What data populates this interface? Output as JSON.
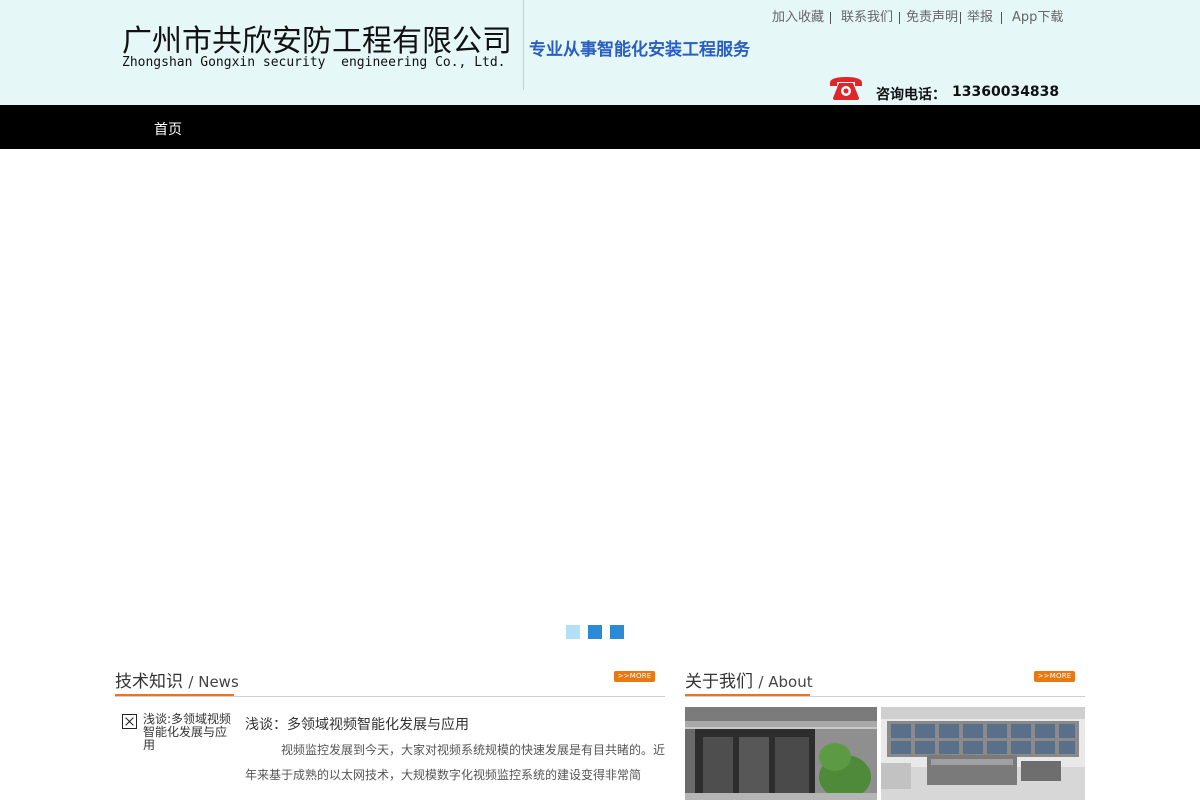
{
  "header": {
    "company_cn": "广州市共欣安防工程有限公司",
    "company_en": "Zhongshan Gongxin security  engineering Co., Ltd.",
    "slogan": "专业从事智能化安装工程服务",
    "hotline_label": "咨询电话：",
    "hotline_number": "13360034838",
    "phone_icon": "phone-icon",
    "colors": {
      "background": "#e6f7f8",
      "slogan": "#2a5fc1",
      "phone": "#e0262b"
    }
  },
  "top_links": [
    {
      "label": "加入收藏"
    },
    {
      "label": "联系我们"
    },
    {
      "label": "免责声明"
    },
    {
      "label": "举报"
    },
    {
      "label": "App下载"
    }
  ],
  "nav": {
    "items": [
      {
        "label": "首页"
      }
    ],
    "background": "#000000"
  },
  "banner": {
    "dots": [
      {
        "state": "inactive",
        "color": "#b3e0f5"
      },
      {
        "state": "active",
        "color": "#2b8ad6"
      },
      {
        "state": "active",
        "color": "#2b8ad6"
      }
    ]
  },
  "news": {
    "title": "技术知识",
    "subtitle": "/ News",
    "more_label": ">>MORE",
    "thumb_caption": "浅谈:多领域视频智能化发展与应用",
    "article_title": "浅谈：多领域视频智能化发展与应用",
    "article_excerpt": "视频监控发展到今天，大家对视频系统规模的快速发展是有目共睹的。近年来基于成熟的以太网技术，大规模数字化视频监控系统的建设变得非常简"
  },
  "about": {
    "title": "关于我们",
    "subtitle": "/ About",
    "more_label": ">>MORE"
  },
  "accent_color": "#e8732a"
}
